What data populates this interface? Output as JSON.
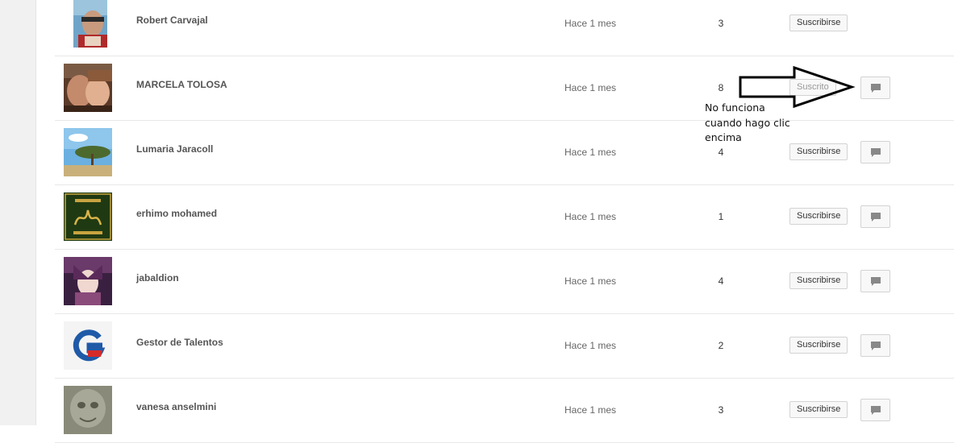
{
  "rows": [
    {
      "name": "Robert Carvajal",
      "date": "Hace 1 mes",
      "count": "3",
      "button": "Suscribirse",
      "avatar": "avatar-robert",
      "has_message_button": false
    },
    {
      "name": "MARCELA TOLOSA",
      "date": "Hace 1 mes",
      "count": "8",
      "button": "Suscrito",
      "avatar": "avatar-marcela",
      "has_message_button": true
    },
    {
      "name": "Lumaria Jaracoll",
      "date": "Hace 1 mes",
      "count": "4",
      "button": "Suscribirse",
      "avatar": "avatar-landscape-tree",
      "has_message_button": true
    },
    {
      "name": "erhimo mohamed",
      "date": "Hace 1 mes",
      "count": "1",
      "button": "Suscribirse",
      "avatar": "avatar-arabic-calligraphy",
      "has_message_button": true
    },
    {
      "name": "jabaldion",
      "date": "Hace 1 mes",
      "count": "4",
      "button": "Suscribirse",
      "avatar": "avatar-anime",
      "has_message_button": true
    },
    {
      "name": "Gestor de Talentos",
      "date": "Hace 1 mes",
      "count": "2",
      "button": "Suscribirse",
      "avatar": "avatar-g-logo",
      "has_message_button": true
    },
    {
      "name": "vanesa anselmini",
      "date": "Hace 1 mes",
      "count": "3",
      "button": "Suscribirse",
      "avatar": "avatar-sculpture",
      "has_message_button": true
    }
  ],
  "annotation": {
    "line1": "No funciona",
    "line2": "cuando hago clic",
    "line3": "encima"
  },
  "icons": {
    "message": "chat-bubble-icon",
    "arrow": "right-arrow-annotation"
  },
  "colors": {
    "gutter": "#f1f1f1",
    "border": "#e8e8e8",
    "button_border": "#d3d3d3"
  }
}
